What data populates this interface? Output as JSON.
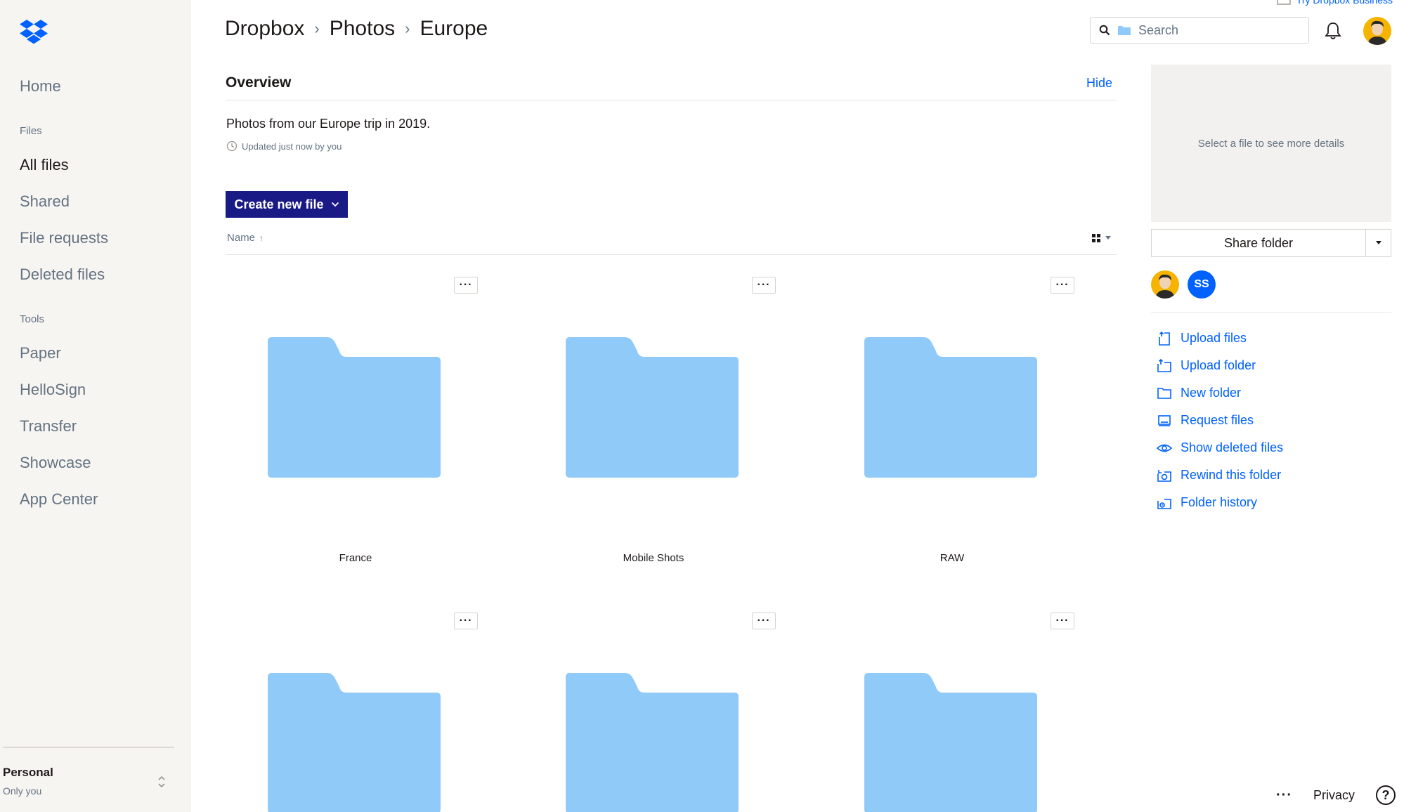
{
  "app": {
    "title": "Dropbox"
  },
  "top_link": "Try Dropbox Business",
  "breadcrumb": [
    {
      "label": "Dropbox"
    },
    {
      "label": "Photos"
    },
    {
      "label": "Europe"
    }
  ],
  "breadcrumb_sep": "›",
  "search": {
    "placeholder": "Search",
    "value": ""
  },
  "sidebar": {
    "home": "Home",
    "files_section": "Files",
    "files_items": [
      {
        "label": "All files",
        "active": true
      },
      {
        "label": "Shared"
      },
      {
        "label": "File requests"
      },
      {
        "label": "Deleted files"
      }
    ],
    "tools_section": "Tools",
    "tools_items": [
      {
        "label": "Paper"
      },
      {
        "label": "HelloSign"
      },
      {
        "label": "Transfer"
      },
      {
        "label": "Showcase"
      },
      {
        "label": "App Center"
      }
    ],
    "account": {
      "name": "Personal",
      "sub": "Only you"
    }
  },
  "overview": {
    "title": "Overview",
    "hide_label": "Hide",
    "description": "Photos from our Europe trip in 2019.",
    "updated": "Updated just now by you"
  },
  "toolbar": {
    "create_label": "Create new file"
  },
  "list": {
    "sort_label": "Name",
    "sort_arrow": "↑"
  },
  "folders": [
    {
      "name": "France"
    },
    {
      "name": "Mobile Shots"
    },
    {
      "name": "RAW"
    },
    {
      "name": ""
    },
    {
      "name": ""
    },
    {
      "name": ""
    }
  ],
  "more_label": "···",
  "details": {
    "empty_text": "Select a file to see more details"
  },
  "share": {
    "label": "Share folder"
  },
  "members": [
    {
      "initials": "SS"
    }
  ],
  "actions": [
    {
      "label": "Upload files",
      "icon": "upload-files-icon"
    },
    {
      "label": "Upload folder",
      "icon": "upload-folder-icon"
    },
    {
      "label": "New folder",
      "icon": "new-folder-icon"
    },
    {
      "label": "Request files",
      "icon": "request-files-icon"
    },
    {
      "label": "Show deleted files",
      "icon": "eye-icon"
    },
    {
      "label": "Rewind this folder",
      "icon": "rewind-icon"
    },
    {
      "label": "Folder history",
      "icon": "history-icon"
    }
  ],
  "footer": {
    "more": "···",
    "privacy": "Privacy",
    "help": "?"
  },
  "colors": {
    "accent": "#0061fe",
    "button": "#1a1a87",
    "folder": "#90caf9",
    "sidebar": "#f7f5f2"
  }
}
